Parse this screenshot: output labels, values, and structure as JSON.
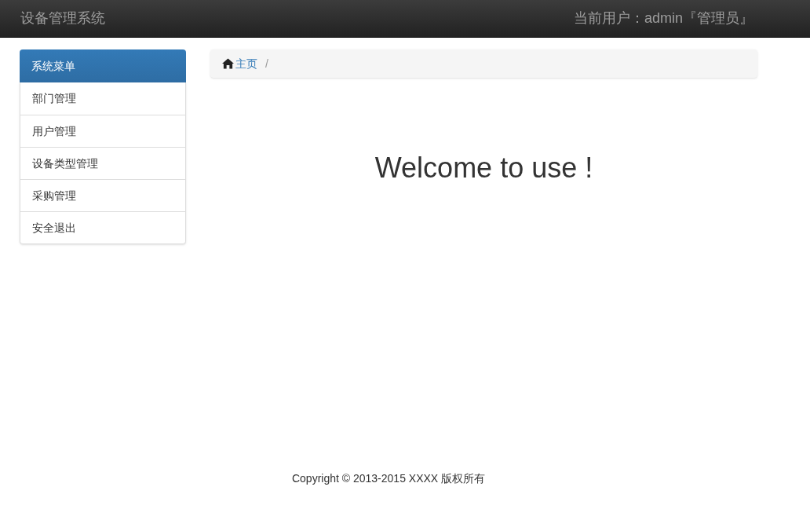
{
  "navbar": {
    "brand": "设备管理系统",
    "user": "当前用户：admin『管理员』"
  },
  "sidebar": {
    "title": "系统菜单",
    "items": [
      {
        "label": "部门管理"
      },
      {
        "label": "用户管理"
      },
      {
        "label": "设备类型管理"
      },
      {
        "label": "采购管理"
      },
      {
        "label": "安全退出"
      }
    ]
  },
  "breadcrumb": {
    "items": [
      {
        "label": "主页"
      }
    ],
    "separator": "/"
  },
  "welcome": "Welcome to use !",
  "footer": "Copyright © 2013-2015 XXXX 版权所有"
}
